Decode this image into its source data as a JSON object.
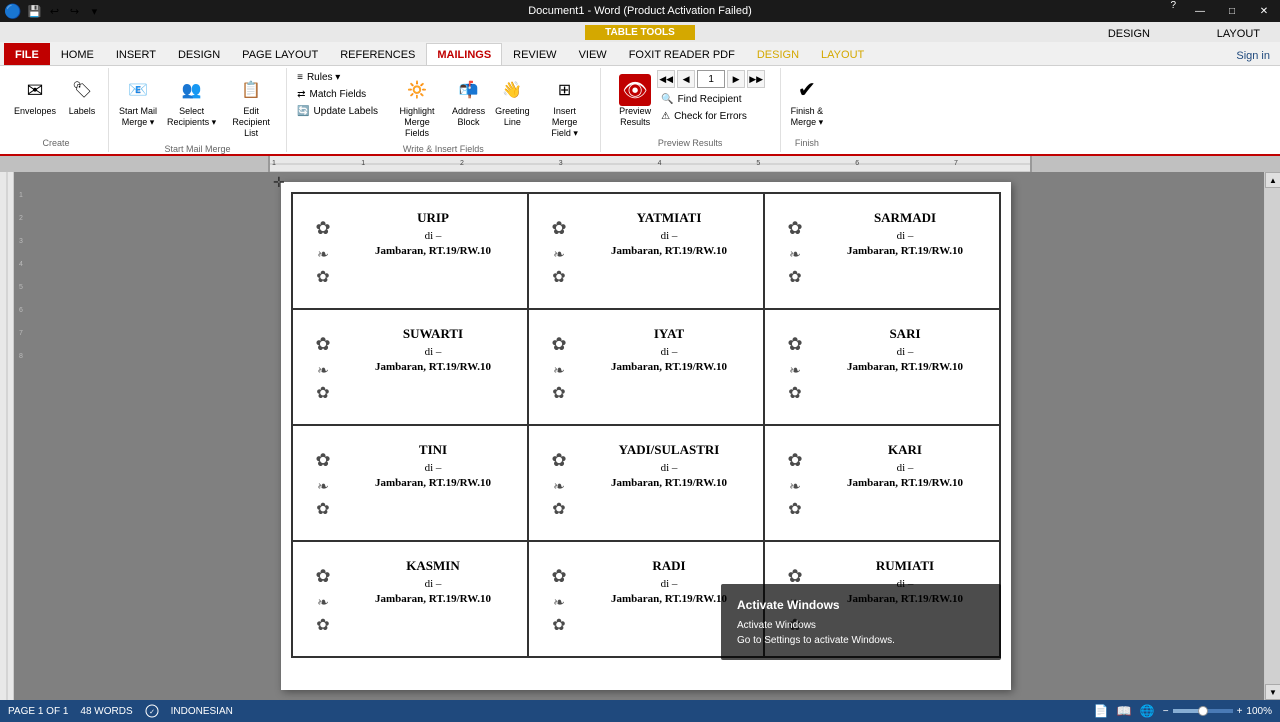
{
  "titlebar": {
    "doc_title": "Document1 - Word (Product Activation Failed)",
    "table_tools": "TABLE TOOLS",
    "min_btn": "—",
    "max_btn": "□",
    "close_btn": "✕",
    "help_btn": "?"
  },
  "ribbon": {
    "tabs": [
      "FILE",
      "HOME",
      "INSERT",
      "DESIGN",
      "PAGE LAYOUT",
      "REFERENCES",
      "MAILINGS",
      "REVIEW",
      "VIEW",
      "FOXIT READER PDF",
      "DESIGN",
      "LAYOUT"
    ],
    "active_tab": "MAILINGS",
    "sign_in": "Sign in",
    "groups": {
      "create": {
        "label": "Create",
        "buttons": [
          {
            "id": "envelopes",
            "label": "Envelopes",
            "icon": "✉"
          },
          {
            "id": "labels",
            "label": "Labels",
            "icon": "🏷"
          }
        ]
      },
      "start_mail_merge": {
        "label": "Start Mail Merge",
        "buttons": [
          {
            "id": "start-mail-merge",
            "label": "Start Mail\nMerge ▾",
            "icon": "📧"
          },
          {
            "id": "select-recipients",
            "label": "Select\nRecipients ▾",
            "icon": "👥"
          },
          {
            "id": "edit-recipient-list",
            "label": "Edit\nRecipient List",
            "icon": "📋"
          }
        ]
      },
      "write_insert": {
        "label": "Write & Insert Fields",
        "buttons": [
          {
            "id": "highlight-merge-fields",
            "label": "Highlight\nMerge Fields",
            "icon": "🔆"
          },
          {
            "id": "address-block",
            "label": "Address\nBlock",
            "icon": "📬"
          },
          {
            "id": "greeting-line",
            "label": "Greeting\nLine",
            "icon": "👋"
          },
          {
            "id": "insert-merge-field",
            "label": "Insert Merge\nField ▾",
            "icon": "⊞"
          }
        ],
        "small_btns": [
          {
            "id": "rules",
            "label": "Rules ▾",
            "icon": "≡"
          },
          {
            "id": "match-fields",
            "label": "Match Fields",
            "icon": "⇄"
          },
          {
            "id": "update-labels",
            "label": "Update Labels",
            "icon": "🔄"
          }
        ]
      },
      "preview_results": {
        "label": "Preview Results",
        "preview_btn": {
          "id": "preview-results",
          "label": "Preview\nResults",
          "icon": "👁"
        },
        "nav": {
          "first": "◀◀",
          "prev": "◀",
          "current": "1",
          "next": "▶",
          "last": "▶▶"
        },
        "small_btns": [
          {
            "id": "find-recipient",
            "label": "Find Recipient",
            "icon": "🔍"
          },
          {
            "id": "check-for-errors",
            "label": "Check for Errors",
            "icon": "⚠"
          }
        ]
      },
      "finish": {
        "label": "Finish",
        "buttons": [
          {
            "id": "finish-merge",
            "label": "Finish &\nMerge ▾",
            "icon": "✔"
          }
        ]
      }
    }
  },
  "document": {
    "labels": [
      {
        "name": "URIP",
        "di": "di –",
        "address": "Jambaran, RT.19/RW.10"
      },
      {
        "name": "YATMIATI",
        "di": "di –",
        "address": "Jambaran, RT.19/RW.10"
      },
      {
        "name": "SARMADI",
        "di": "di –",
        "address": "Jambaran, RT.19/RW.10"
      },
      {
        "name": "SUWARTI",
        "di": "di –",
        "address": "Jambaran, RT.19/RW.10"
      },
      {
        "name": "IYAT",
        "di": "di –",
        "address": "Jambaran, RT.19/RW.10"
      },
      {
        "name": "SARI",
        "di": "di –",
        "address": "Jambaran, RT.19/RW.10"
      },
      {
        "name": "TINI",
        "di": "di –",
        "address": "Jambaran, RT.19/RW.10"
      },
      {
        "name": "YADI/SULASTRI",
        "di": "di –",
        "address": "Jambaran, RT.19/RW.10"
      },
      {
        "name": "KARI",
        "di": "di –",
        "address": "Jambaran, RT.19/RW.10"
      },
      {
        "name": "KASMIN",
        "di": "di –",
        "address": "Jambaran, RT.19/RW.10"
      },
      {
        "name": "RADI",
        "di": "di –",
        "address": "Jambaran, RT.19/RW.10"
      },
      {
        "name": "RUMIATI",
        "di": "di –",
        "address": "Jambaran, RT.19/RW.10"
      }
    ],
    "decoration": "❧"
  },
  "statusbar": {
    "page_info": "PAGE 1 OF 1",
    "words": "48 WORDS",
    "language": "INDONESIAN",
    "zoom": "100%"
  },
  "activation": {
    "title": "Activate Windows",
    "message": "Activate Windows",
    "submessage": "Go to Settings to activate Windows."
  }
}
